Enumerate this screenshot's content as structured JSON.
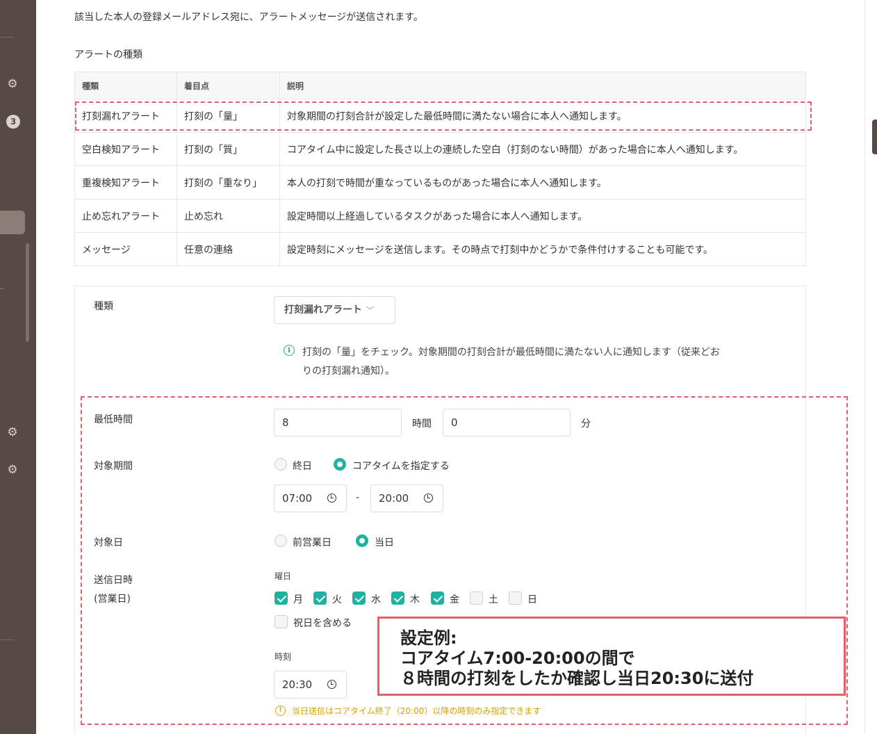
{
  "intro_text": "該当した本人の登録メールアドレス宛に、アラートメッセージが送信されます。",
  "section_title": "アラートの種類",
  "sidebar": {
    "badge": "3",
    "dots": ".."
  },
  "table": {
    "headers": [
      "種類",
      "着目点",
      "説明"
    ],
    "rows": [
      [
        "打刻漏れアラート",
        "打刻の「量」",
        "対象期間の打刻合計が設定した最低時間に満たない場合に本人へ通知します。"
      ],
      [
        "空白検知アラート",
        "打刻の「質」",
        "コアタイム中に設定した長さ以上の連続した空白（打刻のない時間）があった場合に本人へ通知します。"
      ],
      [
        "重複検知アラート",
        "打刻の「重なり」",
        "本人の打刻で時間が重なっているものがあった場合に本人へ通知します。"
      ],
      [
        "止め忘れアラート",
        "止め忘れ",
        "設定時間以上経過しているタスクがあった場合に本人へ通知します。"
      ],
      [
        "メッセージ",
        "任意の連絡",
        "設定時刻にメッセージを送信します。その時点で打刻中かどうかで条件付けすることも可能です。"
      ]
    ]
  },
  "form": {
    "type_label": "種類",
    "type_value": "打刻漏れアラート",
    "info_line1": "打刻の「量」をチェック。対象期間の打刻合計が最低時間に満たない人に通知します（従来どお",
    "info_line2": "りの打刻漏れ通知）。",
    "min_time_label": "最低時間",
    "hours_value": "8",
    "hours_unit": "時間",
    "minutes_value": "0",
    "minutes_unit": "分",
    "period_label": "対象期間",
    "period_options": [
      "終日",
      "コアタイムを指定する"
    ],
    "period_selected": 1,
    "time_start": "07:00",
    "time_sep": "-",
    "time_end": "20:00",
    "target_day_label": "対象日",
    "target_day_options": [
      "前営業日",
      "当日"
    ],
    "target_day_selected": 1,
    "send_label_line1": "送信日時",
    "send_label_line2": "(営業日)",
    "weekday_label": "曜日",
    "weekdays": [
      {
        "label": "月",
        "checked": true
      },
      {
        "label": "火",
        "checked": true
      },
      {
        "label": "水",
        "checked": true
      },
      {
        "label": "木",
        "checked": true
      },
      {
        "label": "金",
        "checked": true
      },
      {
        "label": "土",
        "checked": false
      },
      {
        "label": "日",
        "checked": false
      }
    ],
    "holiday_label": "祝日を含める",
    "time_label": "時刻",
    "send_time": "20:30",
    "warning": "当日送信はコアタイム終了（20:00）以降の時刻のみ指定できます"
  },
  "callout": {
    "line1": "設定例:",
    "line2": "コアタイム7:00-20:00の間で",
    "line3": "８時間の打刻をしたか確認し当日20:30に送付"
  },
  "colors": {
    "sidebar": "#574945",
    "accent": "#20b2a0",
    "highlight": "#e0606a",
    "warning": "#d9a000"
  }
}
